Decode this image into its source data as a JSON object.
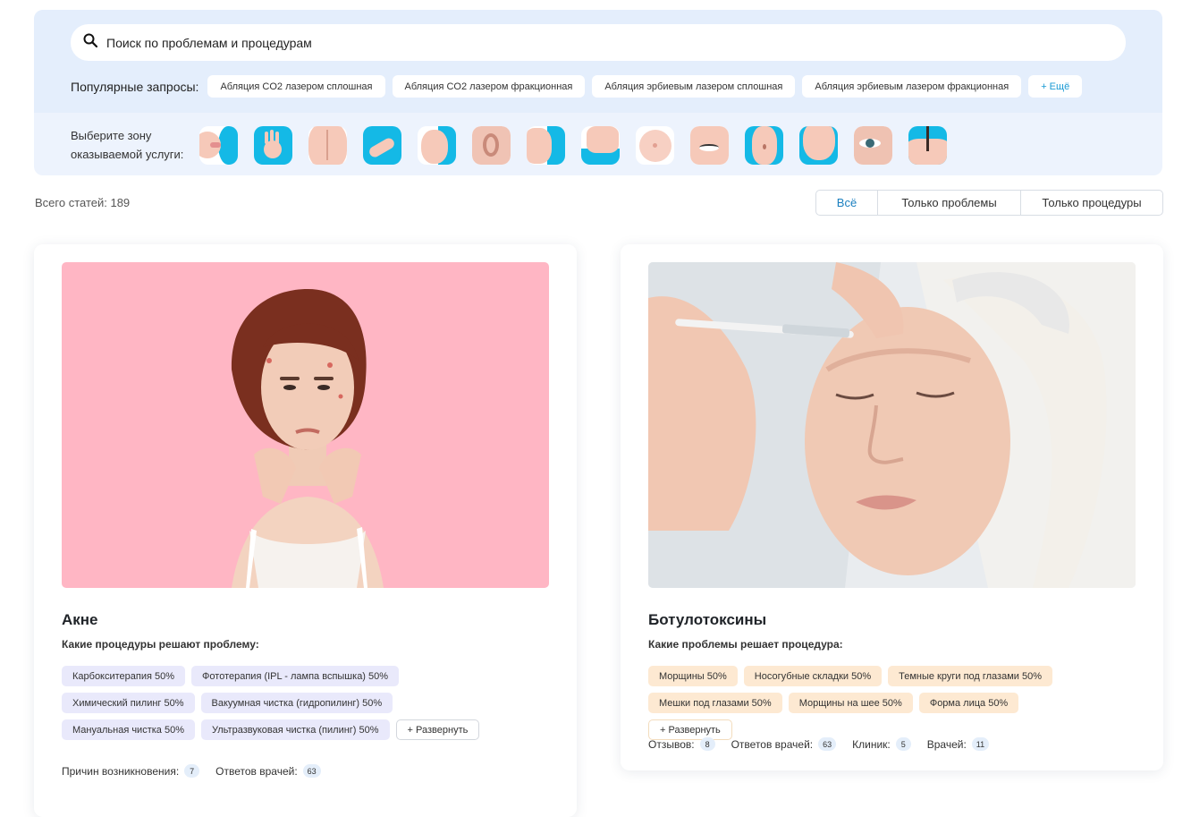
{
  "search": {
    "placeholder": "Поиск по проблемам и процедурам"
  },
  "popular": {
    "label": "Популярные запросы:",
    "chips": [
      "Абляция CO2 лазером сплошная",
      "Абляция CO2 лазером фракционная",
      "Абляция эрбиевым лазером сплошная",
      "Абляция эрбиевым лазером фракционная"
    ],
    "more": "+ Ещё"
  },
  "zones": {
    "label": "Выберите зону оказываемой услуги:",
    "items": [
      "lips-icon",
      "hand-icon",
      "back-icon",
      "arm-icon",
      "face-profile-icon",
      "ear-icon",
      "nose-icon",
      "neck-icon",
      "breast-icon",
      "eye-icon",
      "belly-icon",
      "intimate-zone-icon",
      "eye-closeup-icon",
      "hair-follicle-icon"
    ]
  },
  "summary": {
    "total": "Всего статей: 189"
  },
  "filter": {
    "all": "Всё",
    "problems": "Только проблемы",
    "procedures": "Только процедуры"
  },
  "cards": [
    {
      "title": "Акне",
      "subtitle": "Какие процедуры решают проблему:",
      "tags": [
        "Карбокситерапия 50%",
        "Фототерапия (IPL - лампа вспышка) 50%",
        "Химический пилинг 50%",
        "Вакуумная чистка (гидропилинг) 50%",
        "Мануальная чистка 50%",
        "Ультразвуковая чистка (пилинг) 50%"
      ],
      "expand": "+ Развернуть",
      "stats": [
        {
          "label": "Причин возникновения:",
          "value": "7"
        },
        {
          "label": "Ответов врачей:",
          "value": "63"
        }
      ]
    },
    {
      "title": "Ботулотоксины",
      "subtitle": "Какие проблемы решает процедура:",
      "tags": [
        "Морщины 50%",
        "Носогубные складки 50%",
        "Темные круги под глазами 50%",
        "Мешки под глазами 50%",
        "Морщины на шее 50%",
        "Форма лица 50%"
      ],
      "expand": "+ Развернуть",
      "stats": [
        {
          "label": "Отзывов:",
          "value": "8"
        },
        {
          "label": "Ответов врачей:",
          "value": "63"
        },
        {
          "label": "Клиник:",
          "value": "5"
        },
        {
          "label": "Врачей:",
          "value": "11"
        }
      ]
    }
  ],
  "colors": {
    "panel": "#e4eefc",
    "accent": "#1a9ad4",
    "zone_blue": "#14b9e6",
    "tag_purple": "#e9e9fb",
    "tag_peach": "#fde9d2",
    "acne_bg": "#ffb6c4"
  }
}
